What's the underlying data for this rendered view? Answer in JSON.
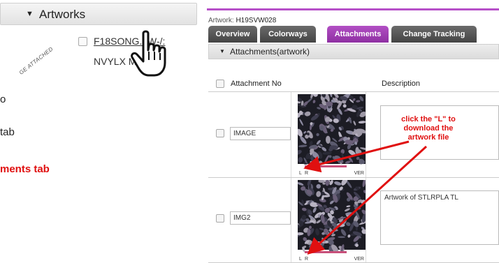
{
  "left": {
    "section_title": "Artworks",
    "stamp_text": "GE ATTACHED",
    "artwork_link_line1": "F18SONG...W-/:",
    "artwork_link_line2": "NVYLX M...",
    "step1": "o",
    "step2": "tab",
    "step3": "ments tab"
  },
  "right": {
    "artwork_label": "Artwork:",
    "artwork_id": "H19SVW028",
    "tabs": [
      {
        "label": "Overview",
        "active": false
      },
      {
        "label": "Colorways",
        "active": false
      },
      {
        "label": "Attachments",
        "active": true
      },
      {
        "label": "Change Tracking",
        "active": false
      }
    ],
    "subsection_title": "Attachments(artwork)",
    "table": {
      "col_attachment_no": "Attachment No",
      "col_description": "Description"
    },
    "rows": [
      {
        "attachment_no": "IMAGE",
        "description": "",
        "thumb_l": "L",
        "thumb_r": "R",
        "thumb_ver": "VER"
      },
      {
        "attachment_no": "IMG2",
        "description": "Artwork of STLRPLA TL",
        "thumb_l": "L",
        "thumb_r": "R",
        "thumb_ver": "VER"
      }
    ],
    "callout": "click the \"L\" to download the artwork file"
  },
  "colors": {
    "accent_purple": "#b64fc8",
    "callout_red": "#e01010"
  },
  "icons": {
    "hand_cursor": "hand-pointer-icon",
    "collapse": "triangle-down-icon"
  }
}
